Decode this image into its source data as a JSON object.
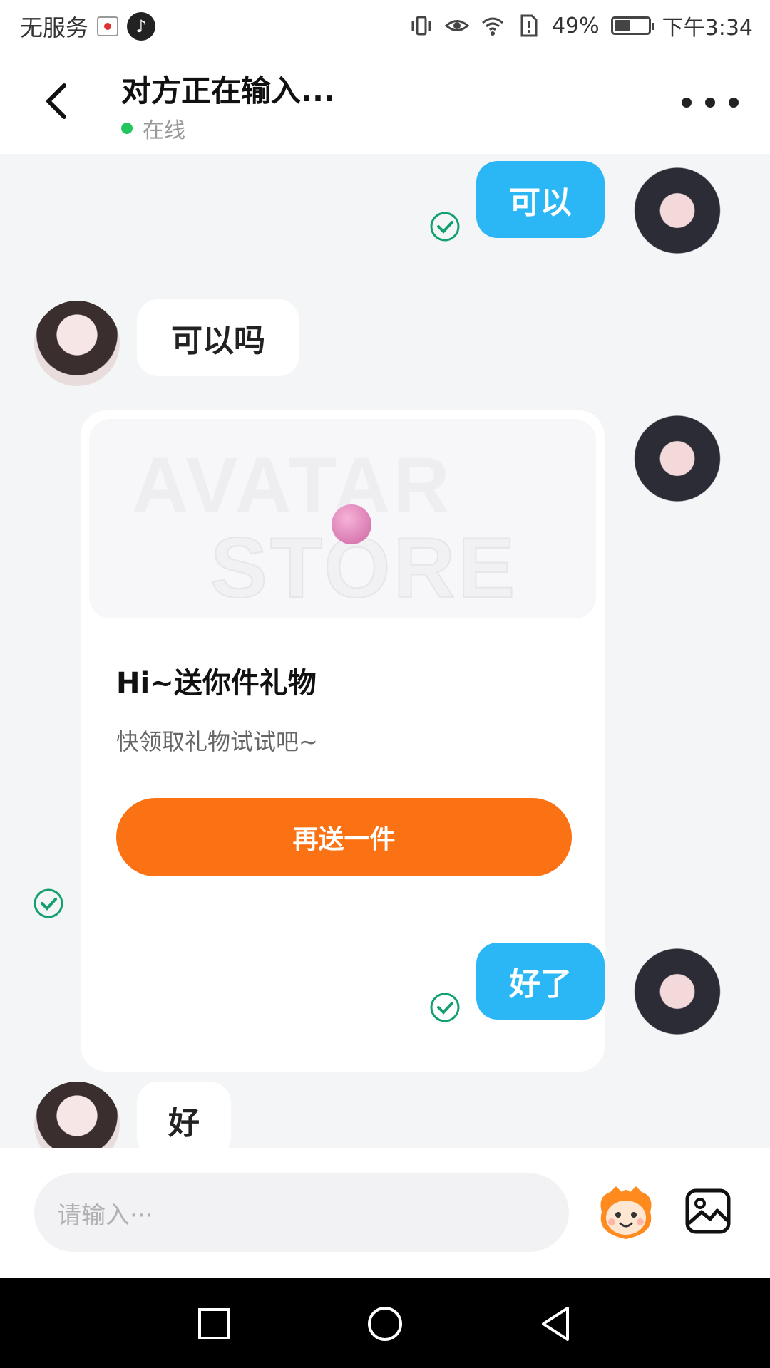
{
  "status_bar": {
    "carrier": "无服务",
    "battery_percent": "49%",
    "battery_level": 0.49,
    "time": "下午3:34",
    "tiktok_mini_label": "♪"
  },
  "header": {
    "title": "对方正在输入...",
    "status": "在线"
  },
  "messages": [
    {
      "direction": "out",
      "text": "可以"
    },
    {
      "direction": "in",
      "text": "可以吗"
    },
    {
      "direction": "out",
      "type": "gift",
      "gift": {
        "watermark_line1": "AVATAR",
        "watermark_line2": "STORE",
        "title": "Hi~送你件礼物",
        "subtitle": "快领取礼物试试吧~",
        "button": "再送一件"
      }
    },
    {
      "direction": "out",
      "text": "好了"
    },
    {
      "direction": "in",
      "text": "好"
    }
  ],
  "input_bar": {
    "placeholder": "请输入···"
  },
  "colors": {
    "outgoing_bubble": "#2bb7f5",
    "gift_button": "#fb7214",
    "online_dot": "#22c55e",
    "read_check": "#14a06e"
  },
  "icons": {
    "back": "back-arrow-icon",
    "more": "more-dots-icon",
    "read": "read-check-icon",
    "emoji": "emoji-face-icon",
    "image": "image-icon",
    "nav_recent": "square-icon",
    "nav_home": "circle-icon",
    "nav_back": "triangle-back-icon"
  }
}
